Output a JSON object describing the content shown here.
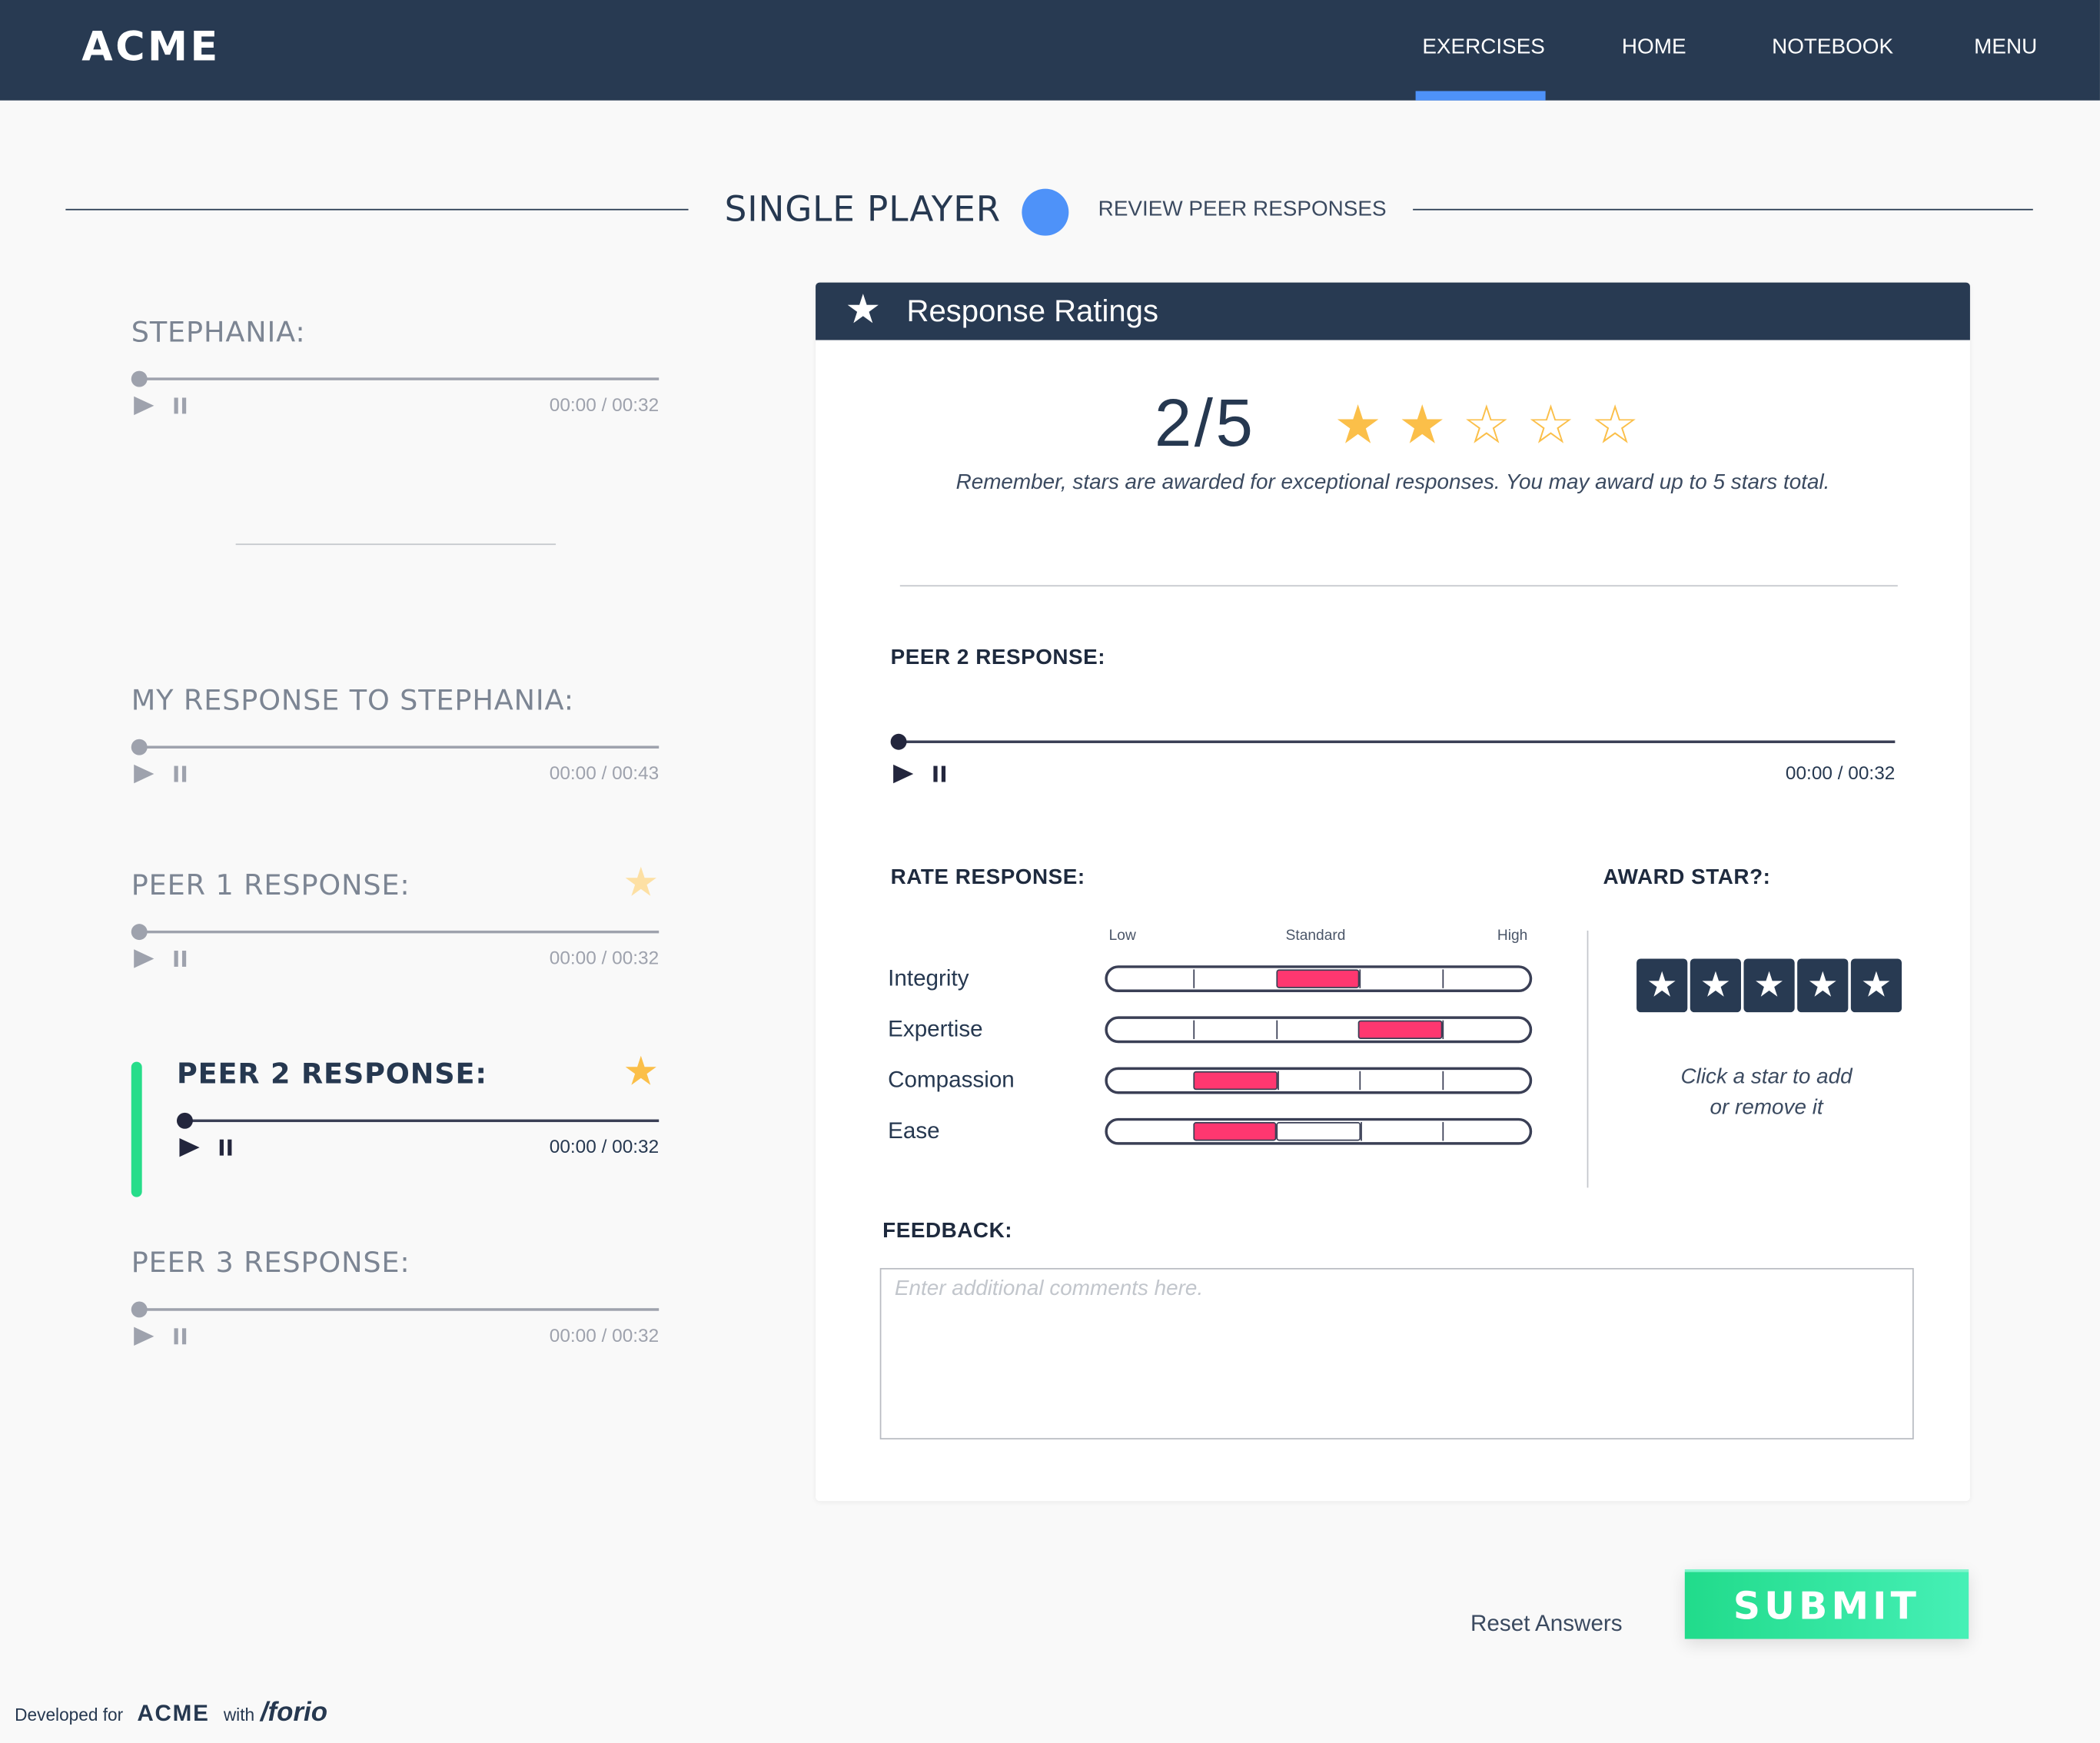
{
  "nav": {
    "logo": "ACME",
    "items": [
      {
        "label": "EXERCISES",
        "active": true
      },
      {
        "label": "HOME",
        "active": false
      },
      {
        "label": "NOTEBOOK",
        "active": false
      },
      {
        "label": "MENU",
        "active": false
      }
    ],
    "accent_color": "#4e92f9"
  },
  "mode": {
    "title": "SINGLE PLAYER",
    "subtitle": "REVIEW PEER RESPONSES"
  },
  "sidebar": {
    "items": [
      {
        "title": "STEPHANIA:",
        "time": "00:00 / 00:32",
        "starred": false,
        "active": false
      },
      {
        "title": "MY RESPONSE TO STEPHANIA:",
        "time": "00:00 / 00:43",
        "starred": false,
        "active": false
      },
      {
        "title": "PEER 1 RESPONSE:",
        "time": "00:00 / 00:32",
        "starred": true,
        "active": false
      },
      {
        "title": "PEER 2 RESPONSE:",
        "time": "00:00 / 00:32",
        "starred": true,
        "active": true
      },
      {
        "title": "PEER 3 RESPONSE:",
        "time": "00:00 / 00:32",
        "starred": false,
        "active": false
      }
    ],
    "active_indicator_color": "#27dd8a"
  },
  "panel": {
    "header_title": "Response Ratings",
    "score_text": "2/5",
    "stars_awarded": 2,
    "stars_total": 5,
    "remember_text": "Remember, stars are awarded for exceptional responses. You may award up to 5 stars total.",
    "peer_label": "PEER 2 RESPONSE:",
    "peer_time": "00:00 / 00:32",
    "rate_label": "RATE RESPONSE:",
    "scale_labels": {
      "low": "Low",
      "standard": "Standard",
      "high": "High"
    },
    "ratings": [
      {
        "name": "Integrity",
        "value": 3,
        "max": 5
      },
      {
        "name": "Expertise",
        "value": 4,
        "max": 5
      },
      {
        "name": "Compassion",
        "value": 2,
        "max": 5
      },
      {
        "name": "Ease",
        "value": 2,
        "max": 5,
        "hover": 3
      }
    ],
    "rating_color": "#fe3770",
    "award_label": "AWARD STAR?:",
    "award_hint_line1": "Click a star to add",
    "award_hint_line2": "or remove it",
    "award_star_count": 5,
    "feedback_label": "FEEDBACK:",
    "feedback_placeholder": "Enter additional comments here.",
    "feedback_value": ""
  },
  "actions": {
    "reset_label": "Reset Answers",
    "submit_label": "SUBMIT",
    "submit_color": "#21db8b"
  },
  "footer": {
    "developed_for": "Developed for",
    "brand": "ACME",
    "with": "with",
    "partner": "/forio"
  }
}
